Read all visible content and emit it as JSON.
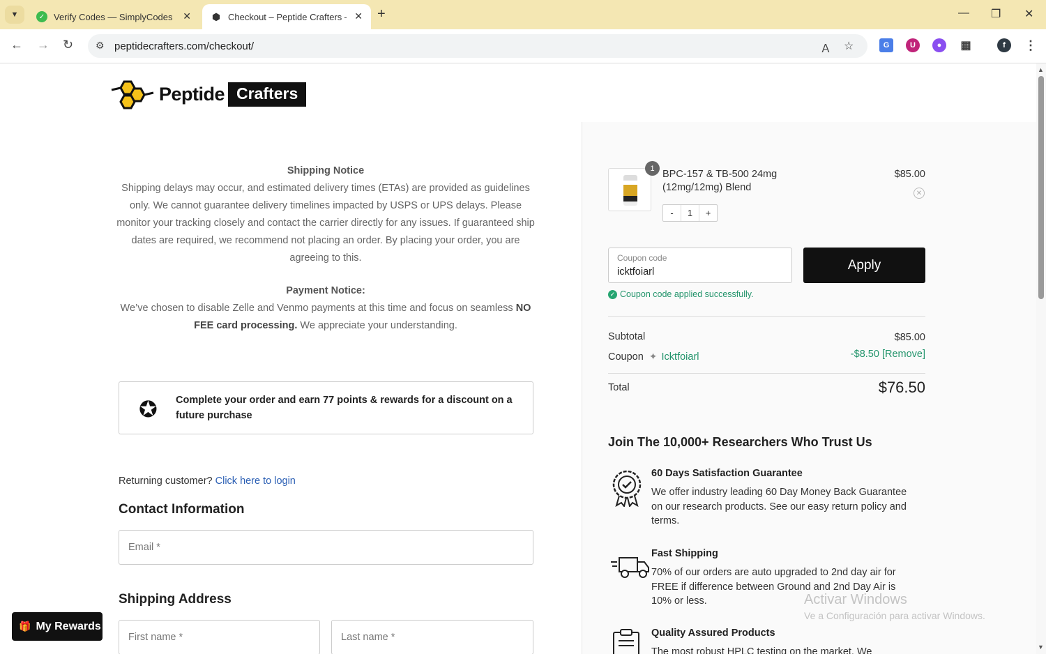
{
  "browser": {
    "tabs": [
      {
        "title": "Verify Codes — SimplyCodes",
        "active": false
      },
      {
        "title": "Checkout – Peptide Crafters – B",
        "active": true
      }
    ],
    "url": "peptidecrafters.com/checkout/",
    "icons": {
      "tab_search": "chevron-down-icon",
      "back": "back-arrow-icon",
      "forward": "forward-arrow-icon",
      "reload": "reload-icon",
      "translate": "translate-icon",
      "bookmark": "star-icon",
      "extensions": "puzzle-icon",
      "menu": "more-vert-icon"
    },
    "profile_initial": "f"
  },
  "logo": {
    "word1": "Peptide",
    "word2": "Crafters"
  },
  "notices": {
    "shipping_head": "Shipping Notice",
    "shipping_body": "Shipping delays may occur, and estimated delivery times (ETAs) are provided as guidelines only. We cannot guarantee delivery timelines impacted by USPS or UPS delays. Please monitor your tracking closely and contact the carrier directly for any issues. If guaranteed ship dates are required, we recommend not placing an order. By placing your order, you are agreeing to this.",
    "payment_head": "Payment Notice:",
    "payment_body_1": "We’ve chosen to disable Zelle and Venmo payments at this time and focus on seamless ",
    "payment_body_bold": "NO FEE card processing.",
    "payment_body_2": " We appreciate your understanding."
  },
  "rewards_notice": "Complete your order and earn 77 points & rewards for a discount on a future purchase",
  "returning": {
    "text": "Returning customer?",
    "link": "Click here to login"
  },
  "contact": {
    "heading": "Contact Information",
    "email_placeholder": "Email *"
  },
  "shipping": {
    "heading": "Shipping Address",
    "first_name": "First name *",
    "last_name": "Last name *"
  },
  "my_rewards": "My Rewards",
  "cart": {
    "quantity_badge": "1",
    "product_name": "BPC-157 & TB-500 24mg (12mg/12mg) Blend",
    "price": "$85.00",
    "stepper": {
      "minus": "-",
      "value": "1",
      "plus": "+"
    },
    "coupon_label": "Coupon code",
    "coupon_value": "icktfoiarl",
    "apply": "Apply",
    "coupon_success": "Coupon code applied successfully.",
    "subtotal_label": "Subtotal",
    "subtotal": "$85.00",
    "coupon_row_label": "Coupon",
    "coupon_code_display": "Icktfoiarl",
    "coupon_discount": "-$8.50 [Remove]",
    "total_label": "Total",
    "total": "$76.50"
  },
  "trust": {
    "heading": "Join The 10,000+ Researchers Who Trust Us",
    "features": [
      {
        "icon": "badge-check-icon",
        "title": "60 Days Satisfaction Guarantee",
        "desc": "We offer industry leading 60 Day Money Back Guarantee on our research products. See our easy return policy and terms."
      },
      {
        "icon": "truck-icon",
        "title": "Fast Shipping",
        "desc": "70% of our orders are auto upgraded to 2nd day air for FREE if difference between Ground and 2nd Day Air is 10% or less."
      },
      {
        "icon": "clipboard-icon",
        "title": "Quality Assured Products",
        "desc": "The most robust HPLC testing on the market. We"
      }
    ]
  },
  "watermark": {
    "line1": "Activar Windows",
    "line2": "Ve a Configuración para activar Windows."
  }
}
